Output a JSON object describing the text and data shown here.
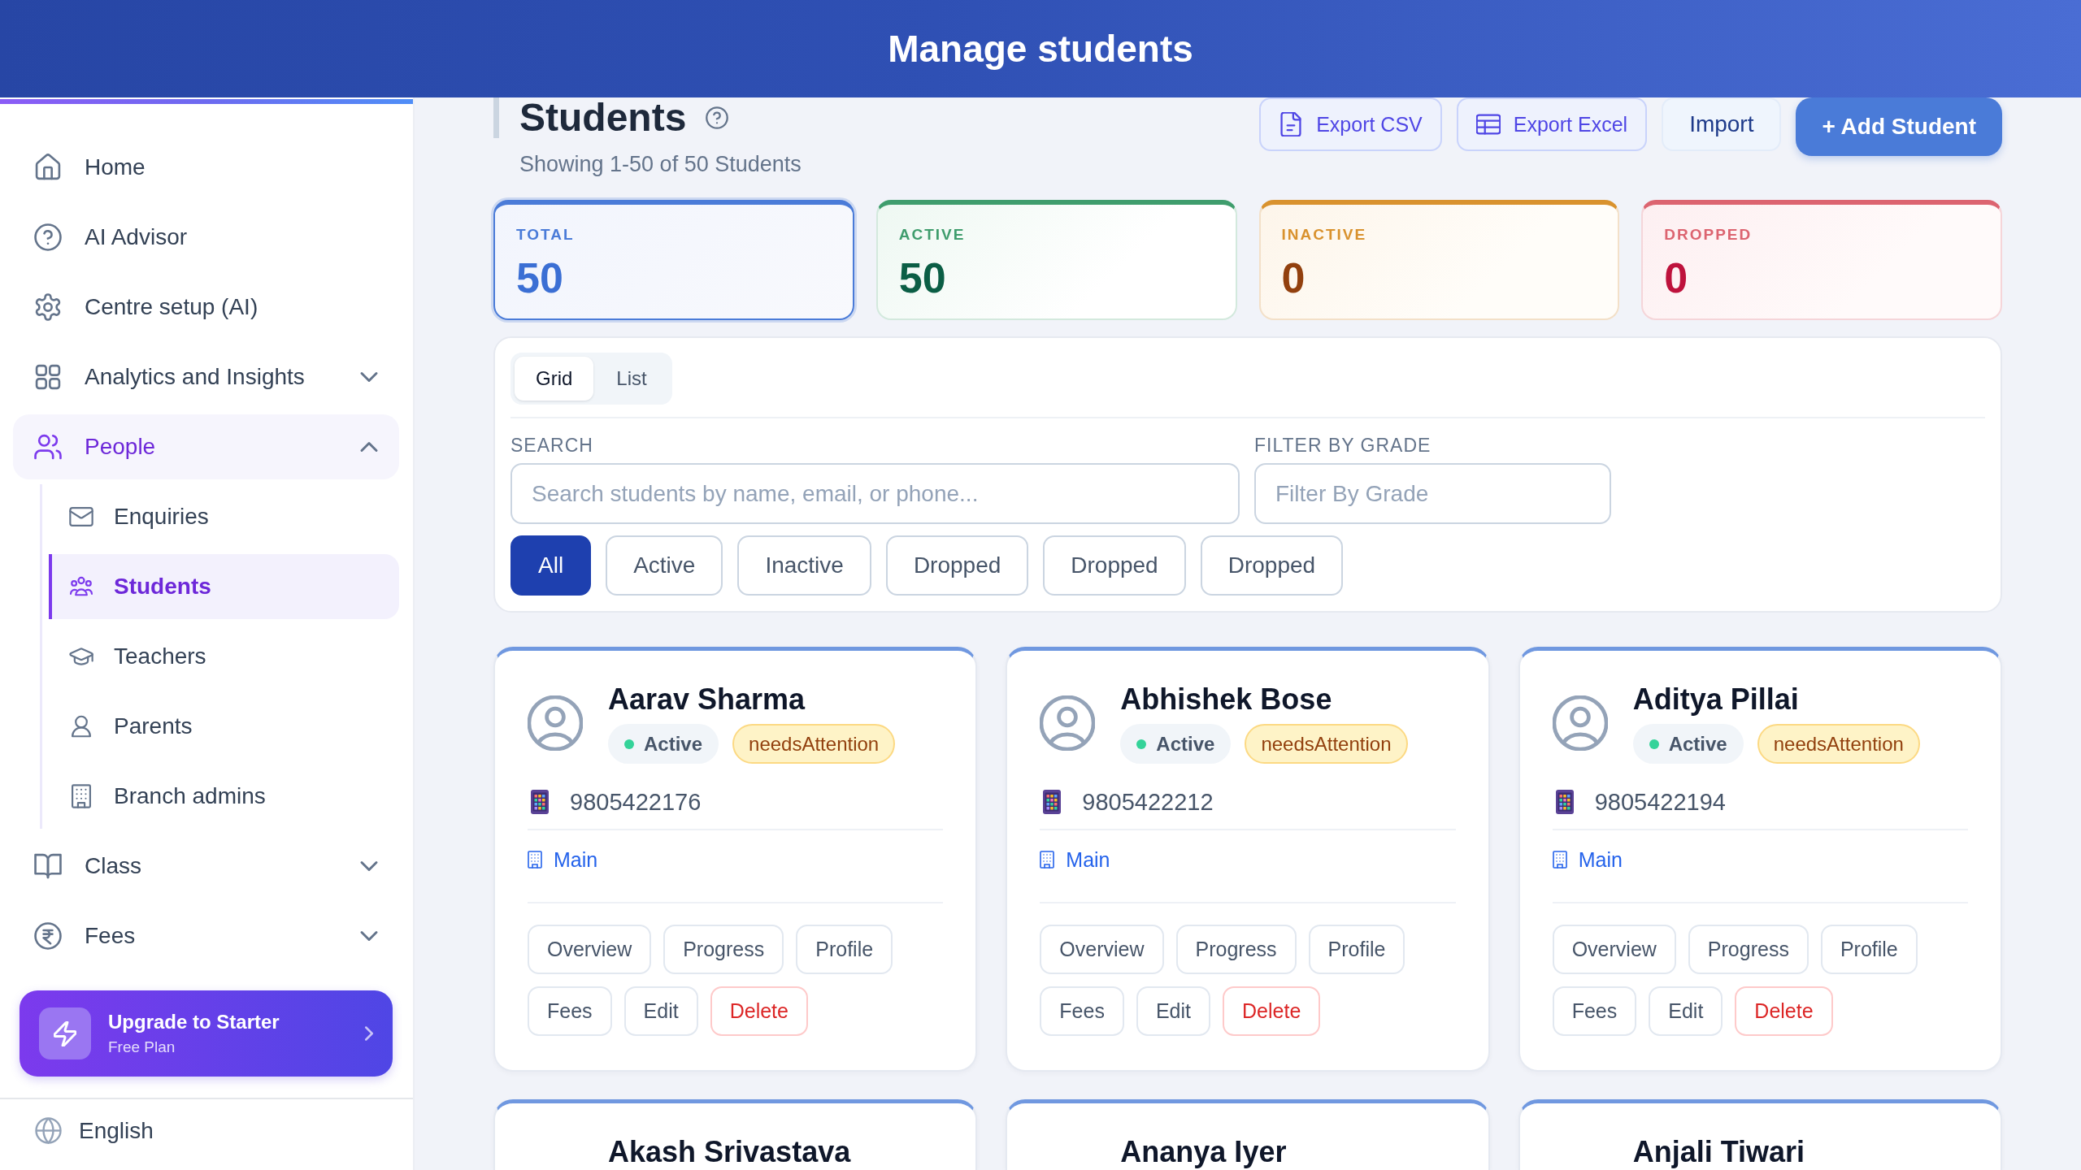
{
  "header": {
    "title": "Manage students"
  },
  "sidebar": {
    "items": [
      {
        "label": "Home",
        "kind": "link",
        "selected": false
      },
      {
        "label": "AI Advisor",
        "kind": "link",
        "selected": false
      },
      {
        "label": "Centre setup (AI)",
        "kind": "link",
        "selected": false
      },
      {
        "label": "Analytics and Insights",
        "kind": "group",
        "expanded": false,
        "selected": false
      },
      {
        "label": "People",
        "kind": "group",
        "expanded": true,
        "selected": true,
        "children": [
          {
            "label": "Enquiries",
            "selected": false
          },
          {
            "label": "Students",
            "selected": true
          },
          {
            "label": "Teachers",
            "selected": false
          },
          {
            "label": "Parents",
            "selected": false
          },
          {
            "label": "Branch admins",
            "selected": false
          }
        ]
      },
      {
        "label": "Class",
        "kind": "group",
        "expanded": false,
        "selected": false
      },
      {
        "label": "Fees",
        "kind": "group",
        "expanded": false,
        "selected": false
      }
    ],
    "upgrade": {
      "title": "Upgrade to Starter",
      "subtitle": "Free Plan"
    },
    "language": {
      "label": "English"
    }
  },
  "page": {
    "title": "Students",
    "subtitle": "Showing 1-50 of 50 Students",
    "actions": [
      {
        "label": "Export CSV",
        "kind": "export"
      },
      {
        "label": "Export Excel",
        "kind": "export"
      },
      {
        "label": "Import",
        "kind": "secondary"
      },
      {
        "label": "+ Add Student",
        "kind": "primary"
      }
    ]
  },
  "stats": [
    {
      "label": "TOTAL",
      "value": "50",
      "color": "#4a7bd8",
      "selected": true
    },
    {
      "label": "ACTIVE",
      "value": "50",
      "color": "#3f9d6d",
      "selected": false
    },
    {
      "label": "INACTIVE",
      "value": "0",
      "color": "#d9922e",
      "selected": false
    },
    {
      "label": "DROPPED",
      "value": "0",
      "color": "#dc6470",
      "selected": false
    }
  ],
  "filters": {
    "view_modes": [
      {
        "label": "Grid",
        "selected": true
      },
      {
        "label": "List",
        "selected": false
      }
    ],
    "search": {
      "label": "SEARCH",
      "placeholder": "Search students by name, email, or phone..."
    },
    "grade": {
      "label": "FILTER BY GRADE",
      "placeholder": "Filter By Grade"
    },
    "status_options": [
      {
        "label": "All",
        "selected": true
      },
      {
        "label": "Active",
        "selected": false
      },
      {
        "label": "Inactive",
        "selected": false
      },
      {
        "label": "Dropped",
        "selected": false
      },
      {
        "label": "Dropped",
        "selected": false
      },
      {
        "label": "Dropped",
        "selected": false
      }
    ]
  },
  "students": [
    {
      "name": "Aarav Sharma",
      "status": "Active",
      "flag": "needsAttention",
      "phone": "9805422176",
      "branch": "Main",
      "actions": [
        {
          "label": "Overview",
          "kind": "default"
        },
        {
          "label": "Progress",
          "kind": "default"
        },
        {
          "label": "Profile",
          "kind": "default"
        },
        {
          "label": "Fees",
          "kind": "default"
        },
        {
          "label": "Edit",
          "kind": "default"
        },
        {
          "label": "Delete",
          "kind": "danger"
        }
      ]
    },
    {
      "name": "Abhishek Bose",
      "status": "Active",
      "flag": "needsAttention",
      "phone": "9805422212",
      "branch": "Main",
      "actions": [
        {
          "label": "Overview",
          "kind": "default"
        },
        {
          "label": "Progress",
          "kind": "default"
        },
        {
          "label": "Profile",
          "kind": "default"
        },
        {
          "label": "Fees",
          "kind": "default"
        },
        {
          "label": "Edit",
          "kind": "default"
        },
        {
          "label": "Delete",
          "kind": "danger"
        }
      ]
    },
    {
      "name": "Aditya Pillai",
      "status": "Active",
      "flag": "needsAttention",
      "phone": "9805422194",
      "branch": "Main",
      "actions": [
        {
          "label": "Overview",
          "kind": "default"
        },
        {
          "label": "Progress",
          "kind": "default"
        },
        {
          "label": "Profile",
          "kind": "default"
        },
        {
          "label": "Fees",
          "kind": "default"
        },
        {
          "label": "Edit",
          "kind": "default"
        },
        {
          "label": "Delete",
          "kind": "danger"
        }
      ]
    },
    {
      "name": "Akash Srivastava"
    },
    {
      "name": "Ananya Iyer"
    },
    {
      "name": "Anjali Tiwari"
    }
  ]
}
